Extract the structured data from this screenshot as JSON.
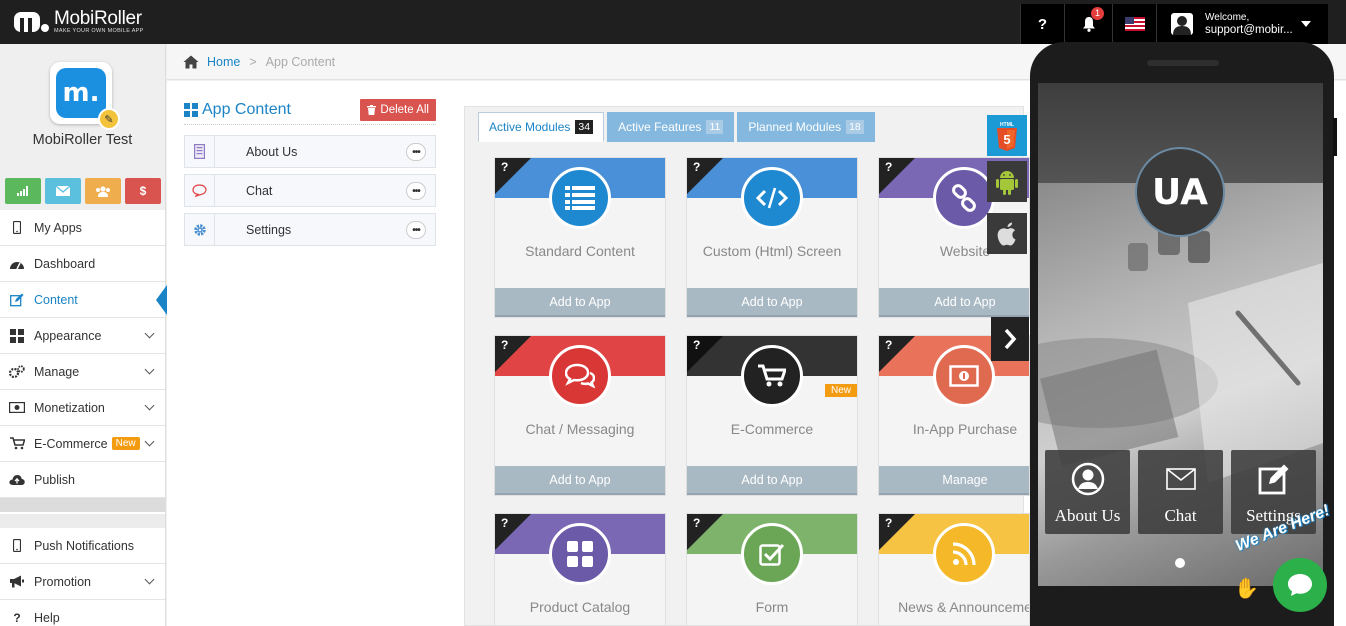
{
  "brand": {
    "name": "MobiRoller",
    "tagline": "MAKE YOUR OWN MOBILE APP"
  },
  "topbar": {
    "help_label": "?",
    "notification_count": "1",
    "welcome": "Welcome,",
    "user_email": "support@mobir..."
  },
  "app": {
    "name": "MobiRoller Test",
    "icon_letter": "m."
  },
  "quick_buttons": [
    {
      "name": "stats",
      "color": "#5cb85c"
    },
    {
      "name": "mail",
      "color": "#5bc0de"
    },
    {
      "name": "users",
      "color": "#f0ad4e"
    },
    {
      "name": "money",
      "color": "#d9534f",
      "label": "$"
    }
  ],
  "nav": {
    "items": [
      {
        "label": "My Apps"
      },
      {
        "label": "Dashboard"
      },
      {
        "label": "Content"
      },
      {
        "label": "Appearance"
      },
      {
        "label": "Manage"
      },
      {
        "label": "Monetization"
      },
      {
        "label": "E-Commerce",
        "badge": "New"
      },
      {
        "label": "Publish"
      }
    ],
    "items2": [
      {
        "label": "Push Notifications"
      },
      {
        "label": "Promotion"
      },
      {
        "label": "Help"
      }
    ]
  },
  "breadcrumb": {
    "home": "Home",
    "separator": ">",
    "current": "App Content"
  },
  "content_panel": {
    "title": "App Content",
    "delete_label": "Delete All",
    "items": [
      {
        "label": "About Us"
      },
      {
        "label": "Chat"
      },
      {
        "label": "Settings"
      }
    ]
  },
  "tabs": [
    {
      "label": "Active Modules",
      "count": "34"
    },
    {
      "label": "Active Features",
      "count": "11"
    },
    {
      "label": "Planned Modules",
      "count": "18"
    }
  ],
  "modules": [
    {
      "title": "Standard Content",
      "button": "Add to App",
      "color": "#4a90d9",
      "icon": "list-icon"
    },
    {
      "title": "Custom (Html) Screen",
      "button": "Add to App",
      "color": "#4a90d9",
      "icon": "code-icon"
    },
    {
      "title": "Website",
      "button": "Add to App",
      "color": "#7b68b5",
      "icon": "link-icon"
    },
    {
      "title": "Chat / Messaging",
      "button": "Add to App",
      "color": "#e04444",
      "icon": "chat-icon"
    },
    {
      "title": "E-Commerce",
      "button": "Add to App",
      "color": "#333333",
      "icon": "cart-icon",
      "badge": "New"
    },
    {
      "title": "In-App Purchase",
      "button": "Manage",
      "color": "#e8735a",
      "icon": "money-icon"
    },
    {
      "title": "Product Catalog",
      "button": "",
      "color": "#7b68b5",
      "icon": "grid-icon"
    },
    {
      "title": "Form",
      "button": "",
      "color": "#7db36a",
      "icon": "check-icon"
    },
    {
      "title": "News & Announceme",
      "button": "",
      "color": "#f6c342",
      "icon": "rss-icon"
    }
  ],
  "card_help": "?",
  "platforms": [
    {
      "name": "html5",
      "label": "HTML 5",
      "color": "#1b9ad6"
    },
    {
      "name": "android",
      "color": "#3a3a3a"
    },
    {
      "name": "apple",
      "color": "#3a3a3a"
    }
  ],
  "phone": {
    "avatar_text": "UA",
    "tiles": [
      {
        "label": "About Us"
      },
      {
        "label": "Chat"
      },
      {
        "label": "Settings"
      }
    ]
  },
  "chat_widget": {
    "text": "We Are Here!"
  }
}
